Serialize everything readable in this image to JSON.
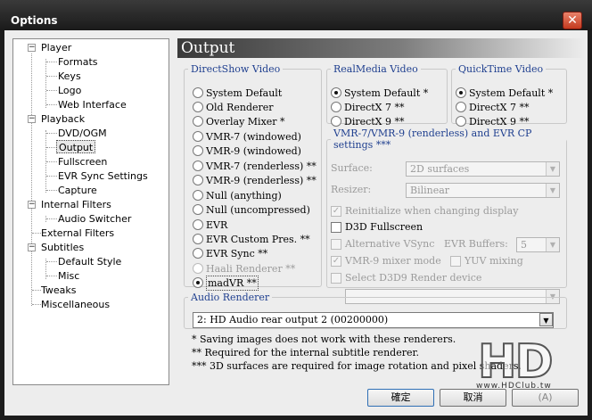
{
  "window": {
    "title": "Options",
    "close_glyph": "✕"
  },
  "tree": {
    "items": [
      {
        "label": "Player",
        "expandable": true
      },
      {
        "label": "Formats"
      },
      {
        "label": "Keys"
      },
      {
        "label": "Logo"
      },
      {
        "label": "Web Interface"
      },
      {
        "label": "Playback",
        "expandable": true
      },
      {
        "label": "DVD/OGM"
      },
      {
        "label": "Output",
        "selected": true
      },
      {
        "label": "Fullscreen"
      },
      {
        "label": "EVR Sync Settings"
      },
      {
        "label": "Capture"
      },
      {
        "label": "Internal Filters",
        "expandable": true
      },
      {
        "label": "Audio Switcher"
      },
      {
        "label": "External Filters"
      },
      {
        "label": "Subtitles",
        "expandable": true
      },
      {
        "label": "Default Style"
      },
      {
        "label": "Misc"
      },
      {
        "label": "Tweaks"
      },
      {
        "label": "Miscellaneous"
      }
    ]
  },
  "page": {
    "title": "Output"
  },
  "directshow": {
    "legend": "DirectShow Video",
    "options": [
      {
        "label": "System Default"
      },
      {
        "label": "Old Renderer"
      },
      {
        "label": "Overlay Mixer *"
      },
      {
        "label": "VMR-7 (windowed)"
      },
      {
        "label": "VMR-9 (windowed)"
      },
      {
        "label": "VMR-7 (renderless) **"
      },
      {
        "label": "VMR-9 (renderless) **"
      },
      {
        "label": "Null (anything)"
      },
      {
        "label": "Null (uncompressed)"
      },
      {
        "label": "EVR"
      },
      {
        "label": "EVR Custom Pres. **"
      },
      {
        "label": "EVR Sync **"
      },
      {
        "label": "Haali Renderer **",
        "disabled": true
      },
      {
        "label": "madVR **",
        "selected": true
      }
    ]
  },
  "realmedia": {
    "legend": "RealMedia Video",
    "options": [
      {
        "label": "System Default *",
        "selected": true
      },
      {
        "label": "DirectX 7 **"
      },
      {
        "label": "DirectX 9 **"
      }
    ]
  },
  "quicktime": {
    "legend": "QuickTime Video",
    "options": [
      {
        "label": "System Default *",
        "selected": true
      },
      {
        "label": "DirectX 7 **"
      },
      {
        "label": "DirectX 9 **"
      }
    ]
  },
  "vmr": {
    "legend": "VMR-7/VMR-9 (renderless) and EVR CP settings ***",
    "surface_label": "Surface:",
    "surface_value": "2D surfaces",
    "resizer_label": "Resizer:",
    "resizer_value": "Bilinear",
    "reinitialize_label": "Reinitialize when changing display",
    "reinitialize_checked": true,
    "d3d_fullscreen_label": "D3D Fullscreen",
    "d3d_fullscreen_checked": false,
    "alt_vsync_label": "Alternative VSync",
    "evr_buffers_label": "EVR Buffers:",
    "evr_buffers_value": "5",
    "vmr9_mixer_label": "VMR-9 mixer mode",
    "vmr9_mixer_checked": true,
    "yuv_mixing_label": "YUV mixing",
    "select_device_label": "Select D3D9 Render device",
    "device_value": ""
  },
  "audio": {
    "legend": "Audio Renderer",
    "value": "2: HD Audio rear output 2 (00200000)"
  },
  "notes": [
    "* Saving images does not work with these renderers.",
    "** Required for the internal subtitle renderer.",
    "*** 3D surfaces are required for image rotation and pixel shaders."
  ],
  "buttons": {
    "ok": "確定",
    "cancel": "取消",
    "apply": "(A)"
  },
  "watermark": {
    "text": "HD",
    "subtext": "www.HDClub.tw"
  },
  "colors": {
    "legend": "#1f3f8f",
    "title_bg": "#1c1c1c",
    "close_red": "#c43a1f"
  }
}
